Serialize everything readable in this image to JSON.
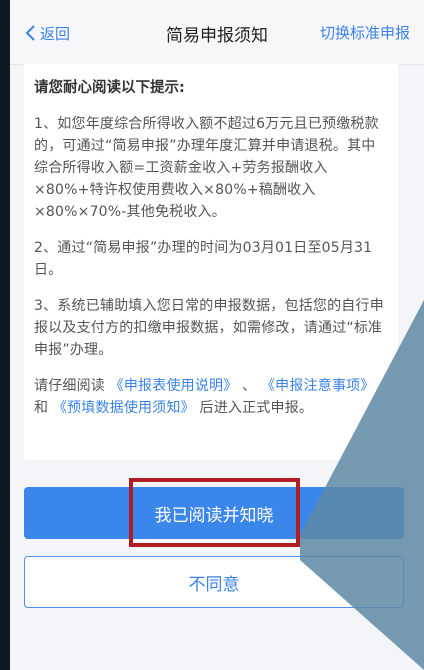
{
  "navbar": {
    "back_label": "返回",
    "title": "简易申报须知",
    "switch_label": "切换标准申报"
  },
  "content": {
    "heading": "请您耐心阅读以下提示:",
    "para1": "1、如您年度综合所得收入额不超过6万元且已预缴税款的，可通过“简易申报”办理年度汇算并申请退税。其中综合所得收入额=工资薪金收入+劳务报酬收入×80%+特许权使用费收入×80%+稿酬收入×80%×70%-其他免税收入。",
    "para2": "2、通过“简易申报”办理的时间为03月01日至05月31日。",
    "para3": "3、系统已辅助填入您日常的申报数据，包括您的自行申报以及支付方的扣缴申报数据，如需修改，请通过“标准申报”办理。",
    "para4_prefix": "请仔细阅读",
    "link1": "《申报表使用说明》",
    "sep1": "、",
    "link2": "《申报注意事项》",
    "sep2": "和",
    "link3": "《预填数据使用须知》",
    "para4_suffix": "后进入正式申报。"
  },
  "buttons": {
    "agree": "我已阅读并知晓",
    "disagree": "不同意"
  },
  "colors": {
    "accent": "#3b86ea",
    "highlight": "#b01e22",
    "background": "#f4f5f8"
  }
}
